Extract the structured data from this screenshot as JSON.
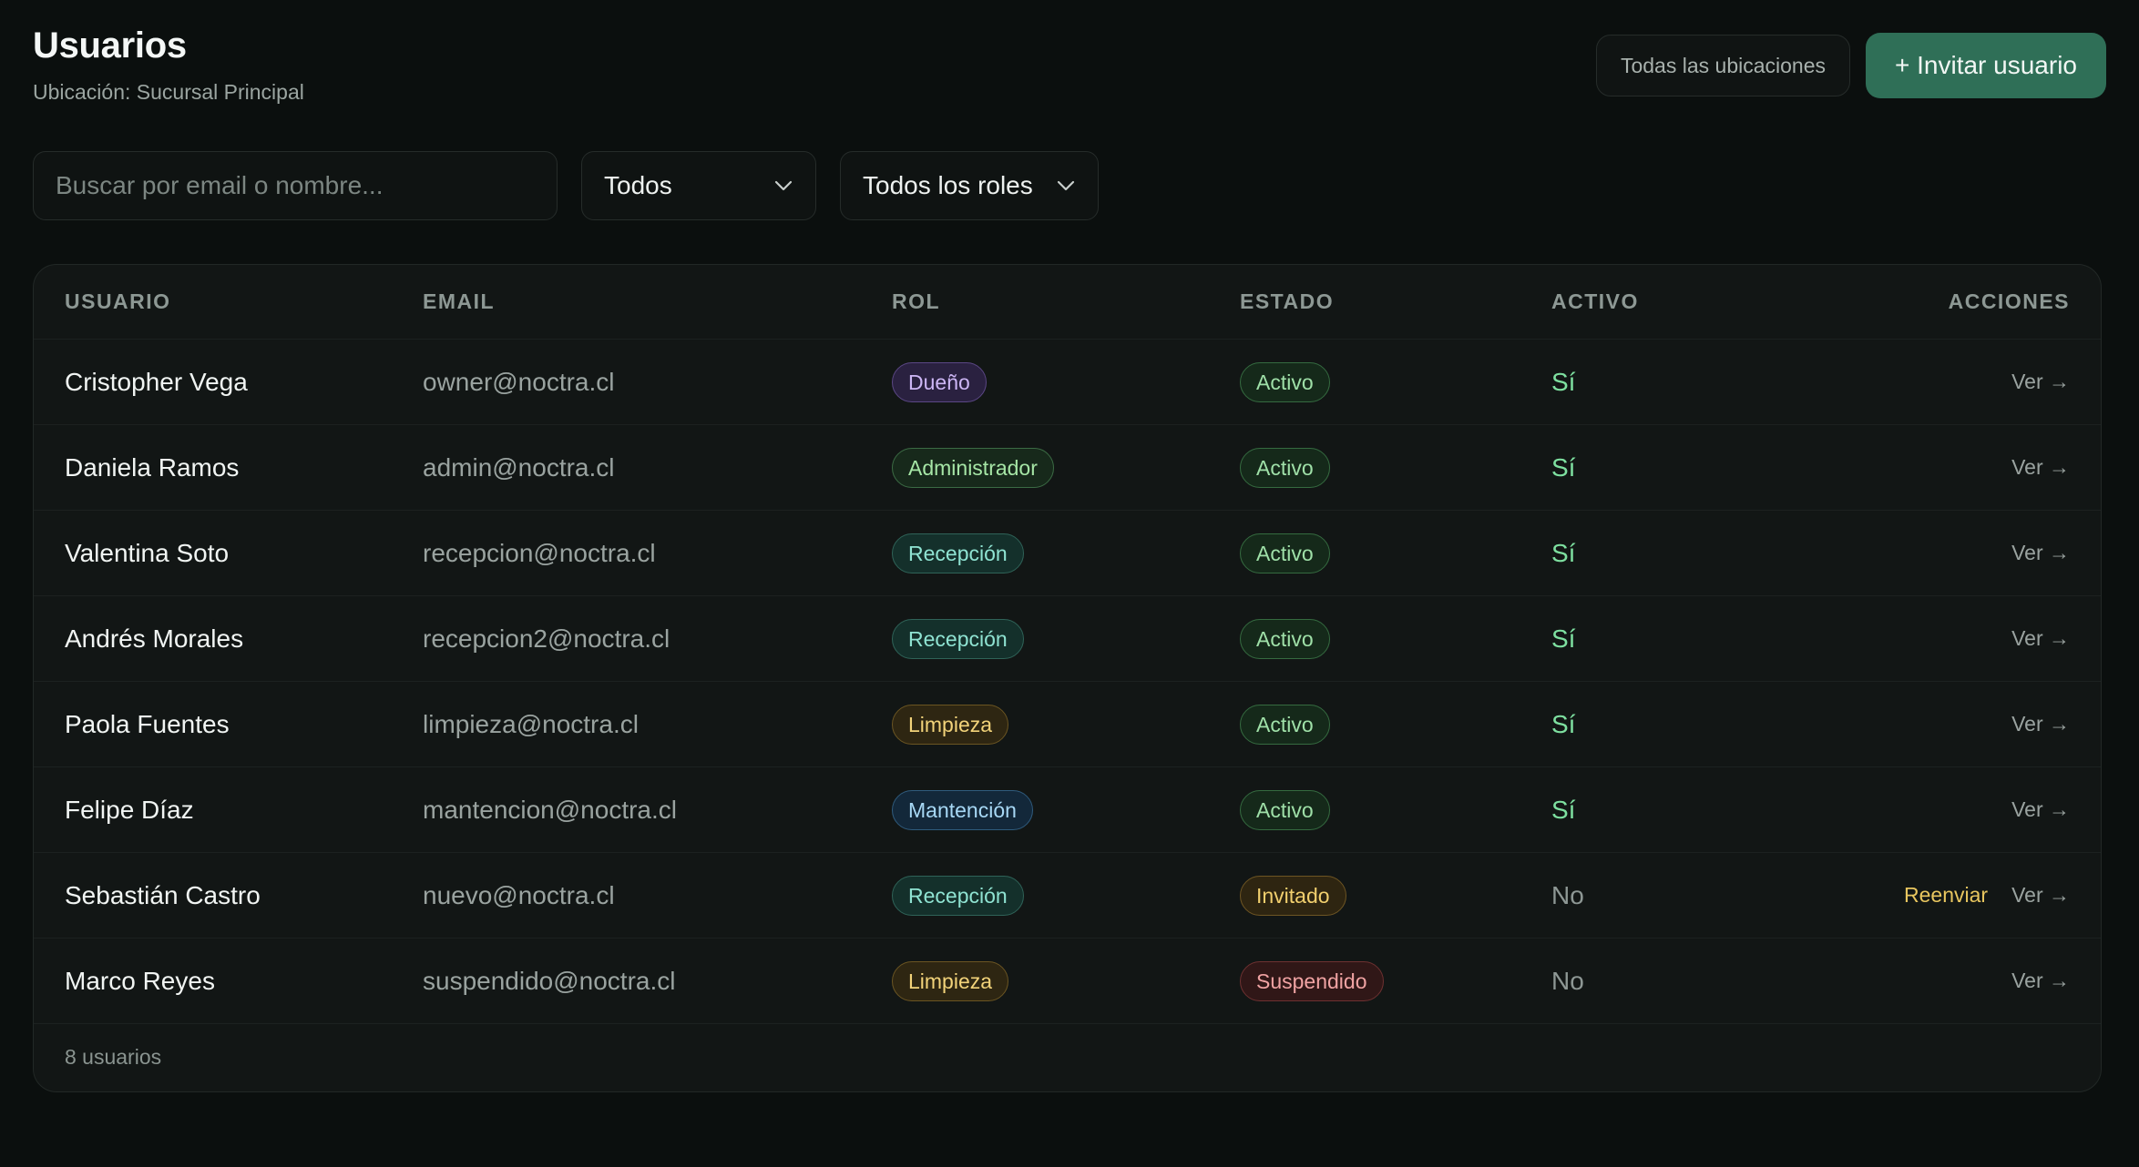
{
  "header": {
    "title": "Usuarios",
    "subtitle": "Ubicación: Sucursal Principal",
    "locations_button": "Todas las ubicaciones",
    "invite_button": "+ Invitar usuario"
  },
  "filters": {
    "search_placeholder": "Buscar por email o nombre...",
    "status_value": "Todos",
    "role_value": "Todos los roles"
  },
  "table": {
    "columns": {
      "user": "USUARIO",
      "email": "EMAIL",
      "role": "ROL",
      "status": "ESTADO",
      "active": "ACTIVO",
      "actions": "ACCIONES"
    },
    "rows": [
      {
        "name": "Cristopher Vega",
        "email": "owner@noctra.cl",
        "role": "Dueño",
        "role_kind": "owner",
        "status": "Activo",
        "status_kind": "active",
        "active": "Sí",
        "active_kind": "yes",
        "view": "Ver →",
        "resend": ""
      },
      {
        "name": "Daniela Ramos",
        "email": "admin@noctra.cl",
        "role": "Administrador",
        "role_kind": "admin",
        "status": "Activo",
        "status_kind": "active",
        "active": "Sí",
        "active_kind": "yes",
        "view": "Ver →",
        "resend": ""
      },
      {
        "name": "Valentina Soto",
        "email": "recepcion@noctra.cl",
        "role": "Recepción",
        "role_kind": "reception",
        "status": "Activo",
        "status_kind": "active",
        "active": "Sí",
        "active_kind": "yes",
        "view": "Ver →",
        "resend": ""
      },
      {
        "name": "Andrés Morales",
        "email": "recepcion2@noctra.cl",
        "role": "Recepción",
        "role_kind": "reception",
        "status": "Activo",
        "status_kind": "active",
        "active": "Sí",
        "active_kind": "yes",
        "view": "Ver →",
        "resend": ""
      },
      {
        "name": "Paola Fuentes",
        "email": "limpieza@noctra.cl",
        "role": "Limpieza",
        "role_kind": "cleaning",
        "status": "Activo",
        "status_kind": "active",
        "active": "Sí",
        "active_kind": "yes",
        "view": "Ver →",
        "resend": ""
      },
      {
        "name": "Felipe Díaz",
        "email": "mantencion@noctra.cl",
        "role": "Mantención",
        "role_kind": "maintenance",
        "status": "Activo",
        "status_kind": "active",
        "active": "Sí",
        "active_kind": "yes",
        "view": "Ver →",
        "resend": ""
      },
      {
        "name": "Sebastián Castro",
        "email": "nuevo@noctra.cl",
        "role": "Recepción",
        "role_kind": "reception",
        "status": "Invitado",
        "status_kind": "invited",
        "active": "No",
        "active_kind": "no",
        "view": "Ver →",
        "resend": "Reenviar"
      },
      {
        "name": "Marco Reyes",
        "email": "suspendido@noctra.cl",
        "role": "Limpieza",
        "role_kind": "cleaning",
        "status": "Suspendido",
        "status_kind": "suspended",
        "active": "No",
        "active_kind": "no",
        "view": "Ver →",
        "resend": ""
      }
    ],
    "footer": "8 usuarios"
  },
  "badge_colors": {
    "owner": {
      "text": "#cdb6f5",
      "bg": "#2a2140",
      "border": "#5b4785"
    },
    "admin": {
      "text": "#a6e6a6",
      "bg": "#17291b",
      "border": "#3b6b44"
    },
    "reception": {
      "text": "#8fe3d2",
      "bg": "#14302b",
      "border": "#2f6358"
    },
    "cleaning": {
      "text": "#f2d37a",
      "bg": "#2e2612",
      "border": "#6b5522"
    },
    "maintenance": {
      "text": "#a7d8f5",
      "bg": "#13283a",
      "border": "#2f5b7d"
    },
    "active": {
      "text": "#9fe0a8",
      "bg": "#15291a",
      "border": "#356b40"
    },
    "invited": {
      "text": "#f1cf6e",
      "bg": "#2e2511",
      "border": "#6e5523"
    },
    "suspended": {
      "text": "#f0a3a3",
      "bg": "#301717",
      "border": "#6e3131"
    }
  }
}
